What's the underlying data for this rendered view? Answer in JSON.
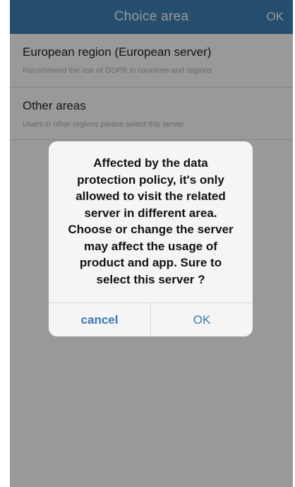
{
  "header": {
    "title": "Choice area",
    "ok_label": "OK"
  },
  "regions": [
    {
      "name": "European region (European server)",
      "description": "Recommend the use of GDPR in countries and regions"
    },
    {
      "name": "Other areas",
      "description": "Users in other regions please select this server"
    }
  ],
  "dialog": {
    "message_lines": [
      "Affected by the data",
      "protection policy, it's only",
      "allowed to visit the related",
      "server in different area.",
      "Choose or change the server",
      "may affect the usage of",
      "product and app. Sure to",
      "select this server ?"
    ],
    "cancel_label": "cancel",
    "ok_label": "OK"
  },
  "colors": {
    "header_bg": "#3f80b6",
    "dialog_button_text": "#3a78b3"
  }
}
